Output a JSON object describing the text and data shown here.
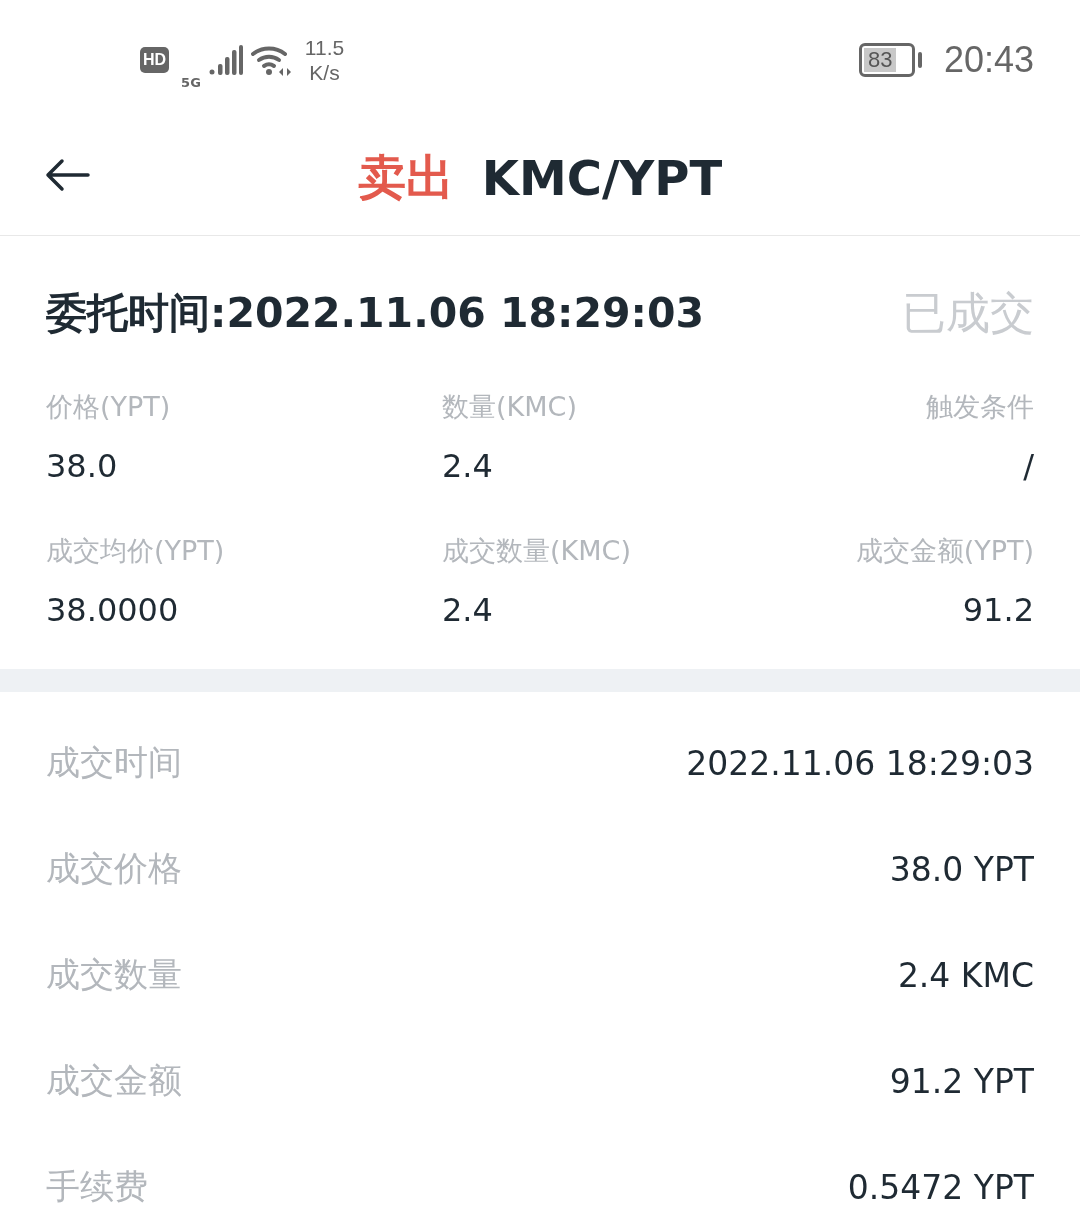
{
  "status_bar": {
    "hd": "HD",
    "network": "5G",
    "speed_value": "11.5",
    "speed_unit": "K/s",
    "battery": "83",
    "time": "20:43"
  },
  "header": {
    "side": "卖出",
    "pair": "KMC/YPT"
  },
  "order": {
    "time_label": "委托时间:2022.11.06 18:29:03",
    "status": "已成交",
    "fields": [
      {
        "label": "价格(YPT)",
        "value": "38.0"
      },
      {
        "label": "数量(KMC)",
        "value": "2.4"
      },
      {
        "label": "触发条件",
        "value": "/"
      },
      {
        "label": "成交均价(YPT)",
        "value": "38.0000"
      },
      {
        "label": "成交数量(KMC)",
        "value": "2.4"
      },
      {
        "label": "成交金额(YPT)",
        "value": "91.2"
      }
    ]
  },
  "details": [
    {
      "label": "成交时间",
      "value": "2022.11.06 18:29:03"
    },
    {
      "label": "成交价格",
      "value": "38.0 YPT"
    },
    {
      "label": "成交数量",
      "value": "2.4 KMC"
    },
    {
      "label": "成交金额",
      "value": "91.2 YPT"
    },
    {
      "label": "手续费",
      "value": "0.5472 YPT"
    }
  ]
}
